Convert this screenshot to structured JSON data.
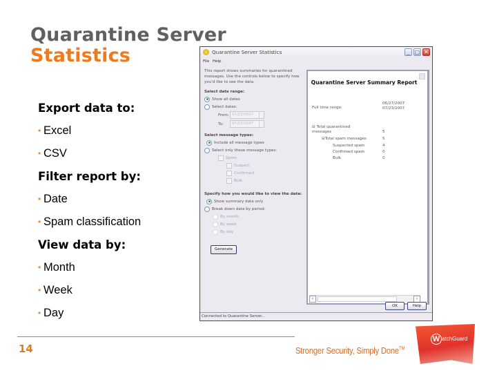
{
  "slide": {
    "title_line1": "Quarantine Server",
    "title_line2": "Statistics",
    "sections": [
      {
        "heading": "Export data to:",
        "bullets": [
          "Excel",
          "CSV"
        ]
      },
      {
        "heading": "Filter report by:",
        "bullets": [
          "Date",
          "Spam classification"
        ]
      },
      {
        "heading": "View data by:",
        "bullets": [
          "Month",
          "Week",
          "Day"
        ]
      }
    ],
    "bullet_glyph": "•",
    "page_number": "14",
    "tagline": "Stronger Security, Simply Done",
    "tagline_mark": "TM",
    "logo_text": "atchGuard",
    "logo_initial": "W",
    "colors": {
      "title_gray": "#606060",
      "accent_orange": "#ee7a1e",
      "logo_red": "#e2312b"
    }
  },
  "window": {
    "title": "Quarantine Server Statistics",
    "controls": {
      "minimize": "_",
      "maximize": "□",
      "close": "✕"
    },
    "menu": [
      "File",
      "Help"
    ],
    "intro": "This report shows summaries for quarantined messages. Use the controls below to specify how you'd like to see the data.",
    "date_range": {
      "label": "Select date range:",
      "options": [
        {
          "label": "Show all dates",
          "selected": true
        },
        {
          "label": "Select dates:",
          "selected": false
        }
      ],
      "from_label": "From:",
      "from_value": "07/23/2007",
      "to_label": "To:",
      "to_value": "07/23/2007"
    },
    "message_types": {
      "label": "Select message types:",
      "options": [
        {
          "label": "Include all message types",
          "selected": true
        },
        {
          "label": "Select only these message types:",
          "selected": false
        }
      ],
      "checkboxes": [
        {
          "label": "Spam",
          "checked": false
        },
        {
          "label": "Suspect",
          "checked": false
        },
        {
          "label": "Confirmed",
          "checked": false
        },
        {
          "label": "Bulk",
          "checked": false
        }
      ]
    },
    "view_by": {
      "label": "Specify how you would like to view the data:",
      "options": [
        {
          "label": "Show summary data only",
          "selected": true
        },
        {
          "label": "Break down data by period:",
          "selected": false
        },
        {
          "label": "By month",
          "selected": false
        },
        {
          "label": "By week",
          "selected": false
        },
        {
          "label": "By day",
          "selected": false
        }
      ]
    },
    "generate_label": "Generate",
    "report": {
      "title": "Quarantine Server Summary Report",
      "date_range_label": "Full time range:",
      "date_range_values": [
        "06/27/2007",
        "07/23/2007"
      ],
      "rows": [
        {
          "label": "Total quarantined messages",
          "value": "5"
        },
        {
          "label": "Total spam messages",
          "value": "5"
        },
        {
          "label": "Suspected spam",
          "value": "4"
        },
        {
          "label": "Confirmed spam",
          "value": "0"
        },
        {
          "label": "Bulk",
          "value": "0"
        }
      ]
    },
    "buttons": {
      "ok": "OK",
      "help": "Help"
    },
    "status": "Connected to Quarantine Server..."
  }
}
